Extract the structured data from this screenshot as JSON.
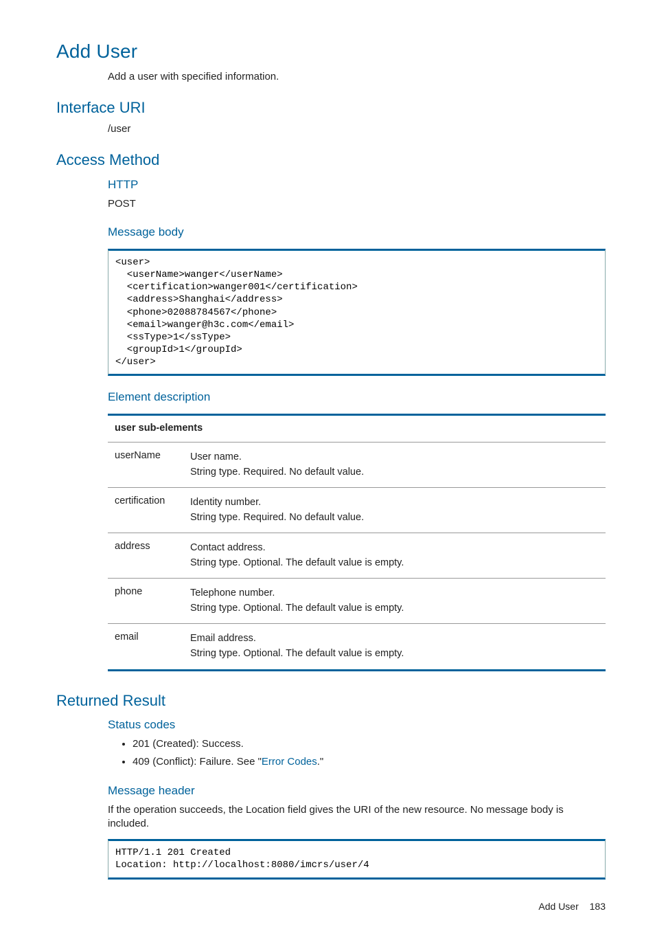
{
  "title": "Add User",
  "intro": "Add a user with specified information.",
  "interface_uri": {
    "heading": "Interface URI",
    "value": "/user"
  },
  "access_method": {
    "heading": "Access Method",
    "http_heading": "HTTP",
    "http_value": "POST",
    "body_heading": "Message body",
    "body_code": "<user>\n  <userName>wanger</userName>\n  <certification>wanger001</certification>\n  <address>Shanghai</address>\n  <phone>02088784567</phone>\n  <email>wanger@h3c.com</email>\n  <ssType>1</ssType>\n  <groupId>1</groupId>\n</user>",
    "elem_heading": "Element description",
    "table": {
      "header": "user sub-elements",
      "rows": [
        {
          "key": "userName",
          "l1": "User name.",
          "l2": "String type. Required. No default value."
        },
        {
          "key": "certification",
          "l1": "Identity number.",
          "l2": "String type. Required. No default value."
        },
        {
          "key": "address",
          "l1": "Contact address.",
          "l2": "String type. Optional. The default value is empty."
        },
        {
          "key": "phone",
          "l1": "Telephone number.",
          "l2": "String type. Optional. The default value is empty."
        },
        {
          "key": "email",
          "l1": "Email address.",
          "l2": "String type. Optional. The default value is empty."
        }
      ]
    }
  },
  "returned": {
    "heading": "Returned Result",
    "status_heading": "Status codes",
    "statuses": [
      {
        "pre": "201 (Created): Success."
      },
      {
        "pre": "409 (Conflict): Failure. See \"",
        "link": "Error Codes",
        "post": ".\""
      }
    ],
    "header_heading": "Message header",
    "header_text": "If the operation succeeds, the Location field gives the URI of the new resource. No message body is included.",
    "header_code": "HTTP/1.1 201 Created\nLocation: http://localhost:8080/imcrs/user/4"
  },
  "footer": {
    "label": "Add User",
    "page": "183"
  }
}
